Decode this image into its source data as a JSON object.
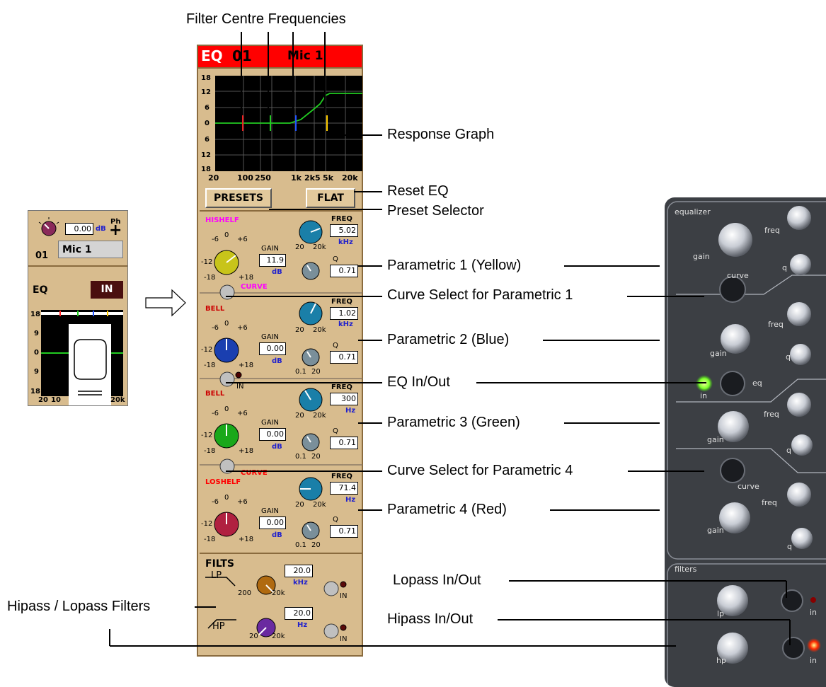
{
  "callouts": {
    "filter_centre": "Filter Centre Frequencies",
    "response_graph": "Response Graph",
    "reset_eq": "Reset EQ",
    "preset_selector": "Preset Selector",
    "param1": "Parametric 1 (Yellow)",
    "curve1": "Curve Select for Parametric 1",
    "param2": "Parametric 2 (Blue)",
    "eq_inout": "EQ In/Out",
    "param3": "Parametric 3 (Green)",
    "curve4": "Curve Select for Parametric 4",
    "param4": "Parametric 4 (Red)",
    "lopass": "Lopass In/Out",
    "hipass_lopass": "Hipass / Lopass Filters",
    "hipass": "Hipass In/Out"
  },
  "mini_strip": {
    "gain_value": "0.00",
    "gain_unit": "dB",
    "phase_label": "Ph",
    "phase_symbol": "+",
    "channel_number": "01",
    "channel_name": "Mic 1",
    "eq_label": "EQ",
    "in_button": "IN",
    "graph_y_labels": [
      "18",
      "9",
      "0",
      "9",
      "18"
    ],
    "graph_x_labels": [
      "20",
      "10",
      "20k"
    ]
  },
  "eq_panel": {
    "title_eq": "EQ",
    "title_channel": "01",
    "title_name": "Mic 1",
    "graph_y_labels": [
      "18",
      "12",
      "6",
      "0",
      "6",
      "12",
      "18"
    ],
    "graph_x_labels": [
      "20",
      "100",
      "250",
      "1k",
      "2k5",
      "5k",
      "20k"
    ],
    "presets_button": "PRESETS",
    "flat_button": "FLAT",
    "freq_label": "FREQ",
    "gain_label": "GAIN",
    "q_label": "Q",
    "q_range": [
      "0.1",
      "20"
    ],
    "freq_range": [
      "20",
      "20k"
    ],
    "gain_scale": [
      "-6",
      "0",
      "+6",
      "-12",
      "-18",
      "+18"
    ],
    "bands": [
      {
        "type": "HISHELF",
        "type_color": "#ff00ff",
        "freq": "5.02",
        "freq_unit": "kHz",
        "gain": "11.9",
        "gain_unit": "dB",
        "q": "0.71",
        "knob_color": "#c8c41a",
        "extra": "CURVE",
        "extra_color": "#ff00ff"
      },
      {
        "type": "BELL",
        "type_color": "#cc0000",
        "freq": "1.02",
        "freq_unit": "kHz",
        "gain": "0.00",
        "gain_unit": "dB",
        "q": "0.71",
        "knob_color": "#1a3fb0",
        "extra": "IN",
        "extra_color": "#000000"
      },
      {
        "type": "BELL",
        "type_color": "#cc0000",
        "freq": "300",
        "freq_unit": "Hz",
        "gain": "0.00",
        "gain_unit": "dB",
        "q": "0.71",
        "knob_color": "#1aa81a",
        "extra": "CURVE",
        "extra_color": "#ff0000"
      },
      {
        "type": "LOSHELF",
        "type_color": "#ff0000",
        "freq": "71.4",
        "freq_unit": "Hz",
        "gain": "0.00",
        "gain_unit": "dB",
        "q": "0.71",
        "knob_color": "#b02040",
        "extra": "",
        "extra_color": "#000000"
      }
    ],
    "filts_label": "FILTS",
    "lp_label": "LP",
    "hp_label": "HP",
    "lp_freq": "20.0",
    "lp_unit": "kHz",
    "hp_freq": "20.0",
    "hp_unit": "Hz",
    "filter_range": [
      "200",
      "20k"
    ],
    "hp_range": [
      "20",
      "20k"
    ],
    "in_label": "IN"
  },
  "hardware": {
    "equalizer": "equalizer",
    "gain": "gain",
    "freq": "freq",
    "q": "q",
    "curve": "curve",
    "eq": "eq",
    "in": "in",
    "filters": "filters",
    "lp": "lp",
    "hp": "hp"
  },
  "colors": {
    "panel_bg": "#d8bc8e",
    "title_red": "#ff0000",
    "graph_bg": "#000000",
    "curve_green": "#22cc22",
    "led_green": "#7cff2a",
    "led_red": "#ff2a00"
  }
}
